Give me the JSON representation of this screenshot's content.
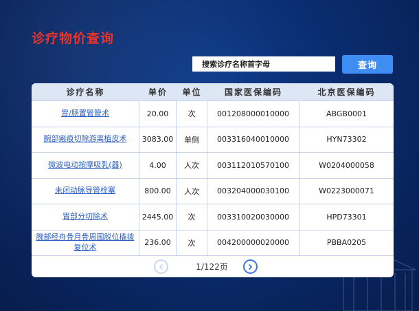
{
  "page": {
    "title": "诊疗物价查询"
  },
  "search": {
    "placeholder": "搜索诊疗名称首字母",
    "button_label": "查询"
  },
  "table": {
    "headers": [
      "诊疗名称",
      "单价",
      "单位",
      "国家医保编码",
      "北京医保编码"
    ],
    "rows": [
      {
        "name": "胃/肠置管管术",
        "price": "20.00",
        "unit": "次",
        "national_code": "001208000010000",
        "beijing_code": "ABGB0001"
      },
      {
        "name": "腕部瘢痕切除游离植皮术",
        "price": "3083.00",
        "unit": "单侧",
        "national_code": "003316040010000",
        "beijing_code": "HYN73302"
      },
      {
        "name": "微波电动按摩吸乳(器)",
        "price": "4.00",
        "unit": "人次",
        "national_code": "003112010570100",
        "beijing_code": "W0204000058"
      },
      {
        "name": "未闭动脉导管栓塞",
        "price": "800.00",
        "unit": "人次",
        "national_code": "003204000030100",
        "beijing_code": "W0223000071"
      },
      {
        "name": "胃部分切除术",
        "price": "2445.00",
        "unit": "次",
        "national_code": "003310020030000",
        "beijing_code": "HPD73301"
      },
      {
        "name": "腕部经舟骨月骨周围脱位橇拨复位术",
        "price": "236.00",
        "unit": "次",
        "national_code": "004200000020000",
        "beijing_code": "PBBA0205"
      }
    ]
  },
  "pagination": {
    "text": "1/122页"
  },
  "colors": {
    "title": "#e8352c",
    "accent": "#3f8cf2",
    "link": "#2b5fc2",
    "background": "#0a2c6e"
  }
}
